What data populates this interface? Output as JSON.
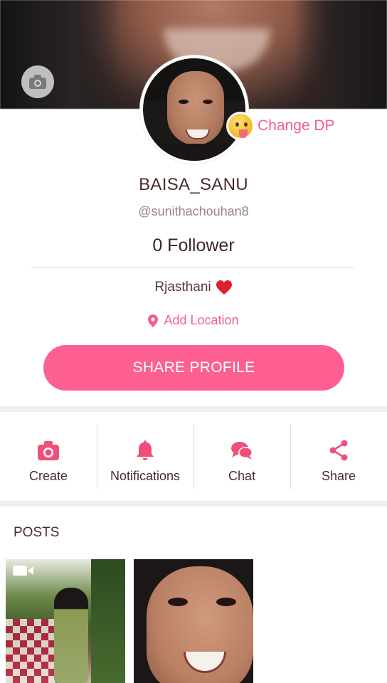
{
  "profile": {
    "name": "BAISA_SANU",
    "handle": "@sunithachouhan8",
    "followers": "0 Follower",
    "bio": "Rjasthani",
    "change_dp_label": "Change DP",
    "add_location_label": "Add Location",
    "share_profile_label": "SHARE PROFILE"
  },
  "actions": [
    {
      "label": "Create",
      "icon": "camera-icon"
    },
    {
      "label": "Notifications",
      "icon": "bell-icon"
    },
    {
      "label": "Chat",
      "icon": "chat-icon"
    },
    {
      "label": "Share",
      "icon": "share-icon"
    }
  ],
  "posts": {
    "title": "POSTS"
  },
  "colors": {
    "accent": "#fd5f91",
    "accent_text": "#f0608a",
    "heart": "#e0202e"
  }
}
